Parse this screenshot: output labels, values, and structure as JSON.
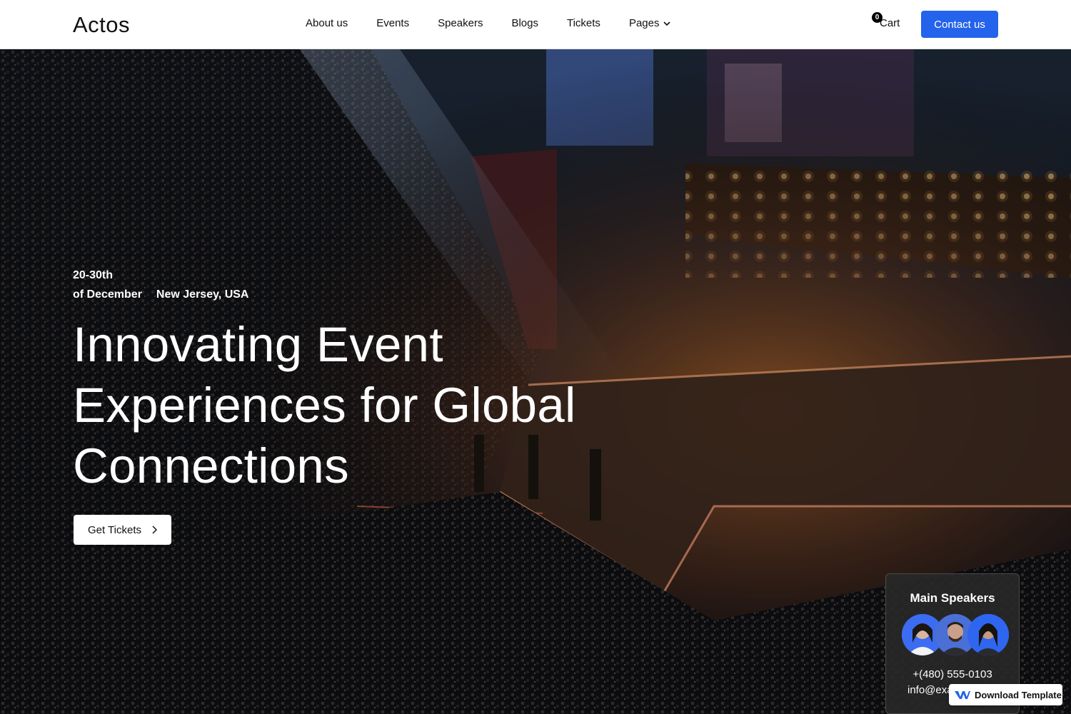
{
  "header": {
    "logo": "Actos",
    "nav": [
      "About us",
      "Events",
      "Speakers",
      "Blogs",
      "Tickets",
      "Pages"
    ],
    "cart_count": "0",
    "cart_label": "Cart",
    "contact_label": "Contact us"
  },
  "hero": {
    "date_range": "20-30th",
    "month": "of December",
    "location": "New Jersey, USA",
    "headline": "Innovating Event Experiences for Global Connections",
    "cta_label": "Get Tickets"
  },
  "speakers_card": {
    "title": "Main Speakers",
    "phone": "+(480) 555-0103",
    "email": "info@exa"
  },
  "badge": {
    "label": "Download Template"
  },
  "colors": {
    "accent": "#2463eb",
    "header_bg": "#ffffff",
    "card_bg": "#282828"
  }
}
